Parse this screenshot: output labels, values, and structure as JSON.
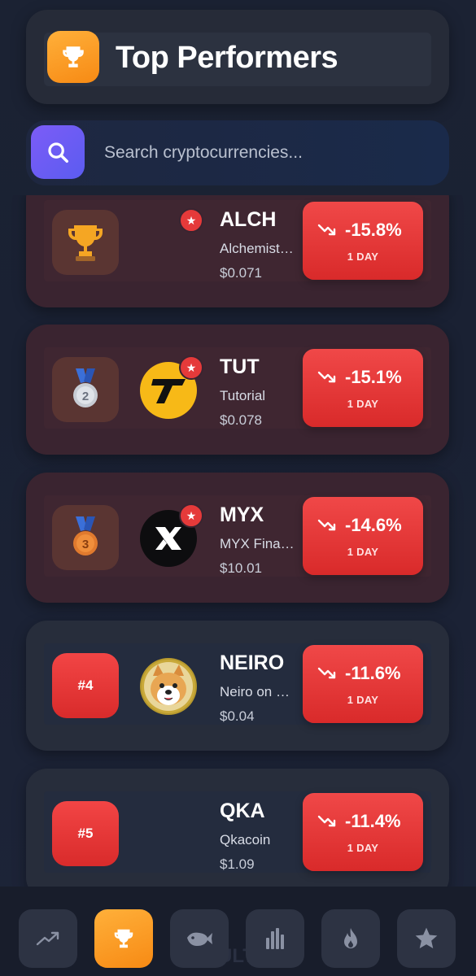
{
  "header": {
    "title": "Top Performers",
    "icon": "trophy-icon"
  },
  "search": {
    "placeholder": "Search cryptocurrencies..."
  },
  "coins": [
    {
      "rank_type": "trophy",
      "symbol": "ALCH",
      "name": "Alchemist AI",
      "price": "$0.071",
      "change": "-15.8%",
      "period": "1 DAY",
      "logo": "none",
      "favorite": true
    },
    {
      "rank_type": "silver-medal",
      "rank_label": "2",
      "symbol": "TUT",
      "name": "Tutorial",
      "price": "$0.078",
      "change": "-15.1%",
      "period": "1 DAY",
      "logo": "tut-logo",
      "favorite": true
    },
    {
      "rank_type": "bronze-medal",
      "rank_label": "3",
      "symbol": "MYX",
      "name": "MYX Finance",
      "price": "$10.01",
      "change": "-14.6%",
      "period": "1 DAY",
      "logo": "myx-logo",
      "favorite": true
    },
    {
      "rank_type": "number",
      "rank_label": "#4",
      "symbol": "NEIRO",
      "name": "Neiro on ETH",
      "price": "$0.04",
      "change": "-11.6%",
      "period": "1 DAY",
      "logo": "neiro-logo",
      "favorite": false
    },
    {
      "rank_type": "number",
      "rank_label": "#5",
      "symbol": "QKA",
      "name": "Qkacoin",
      "price": "$1.09",
      "change": "-11.4%",
      "period": "1 DAY",
      "logo": "none",
      "favorite": false
    }
  ],
  "nav": {
    "items": [
      "trending-icon",
      "trophy-icon",
      "whale-icon",
      "bar-chart-icon",
      "fire-icon",
      "star-icon"
    ],
    "active": "trophy-icon",
    "ghost_text": "ULTIM"
  },
  "colors": {
    "accent_orange": "#f7941d",
    "negative_red": "#e53a3a",
    "search_purple": "#6b5cf4"
  }
}
